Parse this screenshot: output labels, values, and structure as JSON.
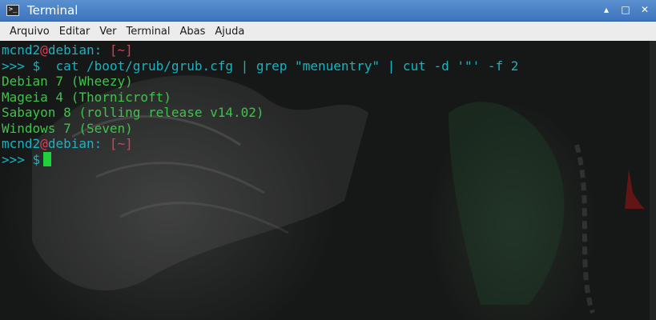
{
  "window": {
    "title": "Terminal",
    "icon": "terminal-icon"
  },
  "wm": {
    "up": "▴",
    "maximize": "□",
    "close": "✕"
  },
  "menu": [
    "Arquivo",
    "Editar",
    "Ver",
    "Terminal",
    "Abas",
    "Ajuda"
  ],
  "terminal": {
    "line1": {
      "user": "mcnd2",
      "at": "@",
      "host": "debian:",
      "path": "[~]"
    },
    "line2": {
      "prompt": ">>> $",
      "command": "  cat /boot/grub/grub.cfg | grep \"menuentry\" | cut -d '\"' -f 2"
    },
    "outputs": [
      "Debian 7 (Wheezy)",
      "Mageia 4 (Thornicroft)",
      "Sabayon 8 (rolling release v14.02)",
      "Windows 7 (Seven)"
    ],
    "line7": {
      "user": "mcnd2",
      "at": "@",
      "host": "debian:",
      "path": "[~]"
    },
    "line8": {
      "prompt": ">>> $"
    }
  },
  "colors": {
    "cyan": "#17b3c0",
    "red": "#e13b5a",
    "green": "#3ec34a",
    "cursor": "#1fd23b",
    "titlebar": "#4a82c6"
  }
}
